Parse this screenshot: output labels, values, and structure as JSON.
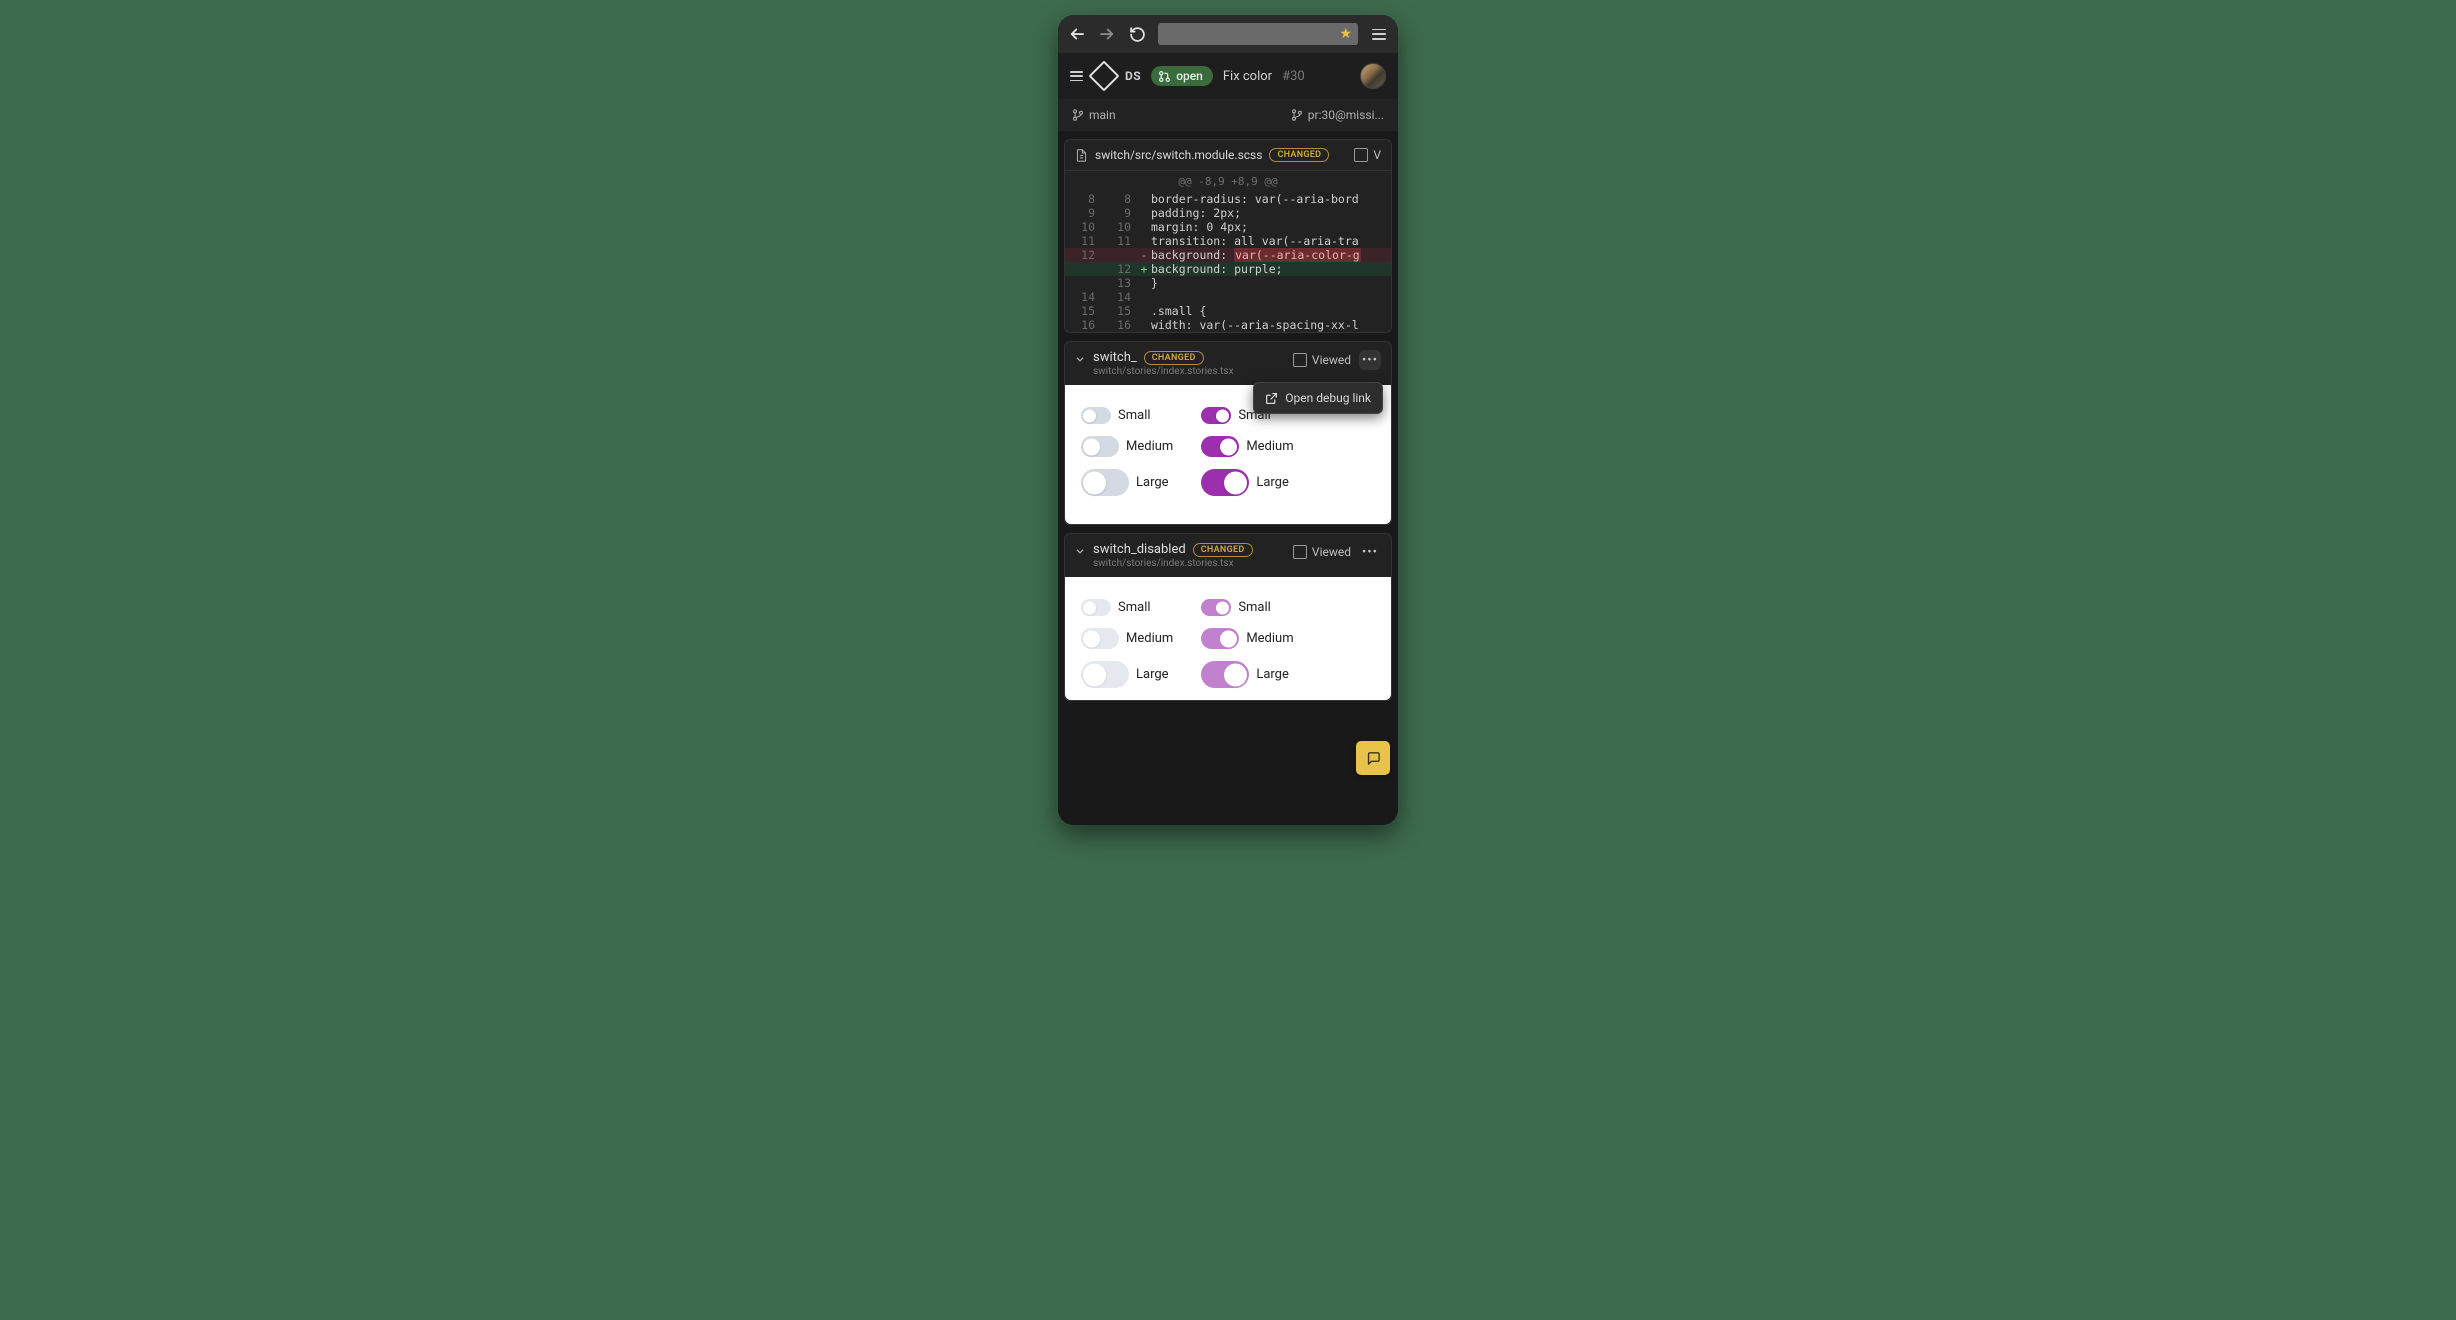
{
  "app": {
    "ds_label": "DS",
    "status": "open",
    "pr_title": "Fix color",
    "pr_number": "#30"
  },
  "branches": {
    "base": "main",
    "compare": "pr:30@missi..."
  },
  "diff": {
    "path": "switch/src/switch.module.scss",
    "badge": "CHANGED",
    "viewed_label": "V",
    "hunk": "@@ -8,9 +8,9 @@",
    "rows": [
      {
        "lo": "8",
        "ln": "8",
        "sign": "",
        "code": "  border-radius: var(--aria-bord"
      },
      {
        "lo": "9",
        "ln": "9",
        "sign": "",
        "code": "  padding: 2px;"
      },
      {
        "lo": "10",
        "ln": "10",
        "sign": "",
        "code": "  margin: 0 4px;"
      },
      {
        "lo": "11",
        "ln": "11",
        "sign": "",
        "code": "  transition: all var(--aria-tra"
      },
      {
        "lo": "12",
        "ln": "",
        "sign": "-",
        "code": "  background: ",
        "hl": "var(--aria-color-g",
        "cls": "del"
      },
      {
        "lo": "",
        "ln": "12",
        "sign": "+",
        "code": "  background: purple;",
        "cls": "add"
      },
      {
        "lo": "",
        "ln": "13",
        "sign": "",
        "code": "}"
      },
      {
        "lo": "14",
        "ln": "14",
        "sign": "",
        "code": ""
      },
      {
        "lo": "15",
        "ln": "15",
        "sign": "",
        "code": ".small {"
      },
      {
        "lo": "16",
        "ln": "16",
        "sign": "",
        "code": "  width: var(--aria-spacing-xx-l"
      }
    ]
  },
  "story1": {
    "title": "switch_",
    "badge": "CHANGED",
    "sub": "switch/stories/index.stories.tsx",
    "viewed_label": "Viewed",
    "menu_item": "Open debug link",
    "switches": {
      "small": "Small",
      "medium": "Medium",
      "large": "Large"
    }
  },
  "story2": {
    "title": "switch_disabled",
    "badge": "CHANGED",
    "sub": "switch/stories/index.stories.tsx",
    "viewed_label": "Viewed",
    "switches": {
      "small": "Small",
      "medium": "Medium",
      "large": "Large"
    }
  },
  "colors": {
    "accent_purple": "#9b2fae",
    "accent_green": "#3a6b3c",
    "accent_gold": "#e8c34a"
  }
}
